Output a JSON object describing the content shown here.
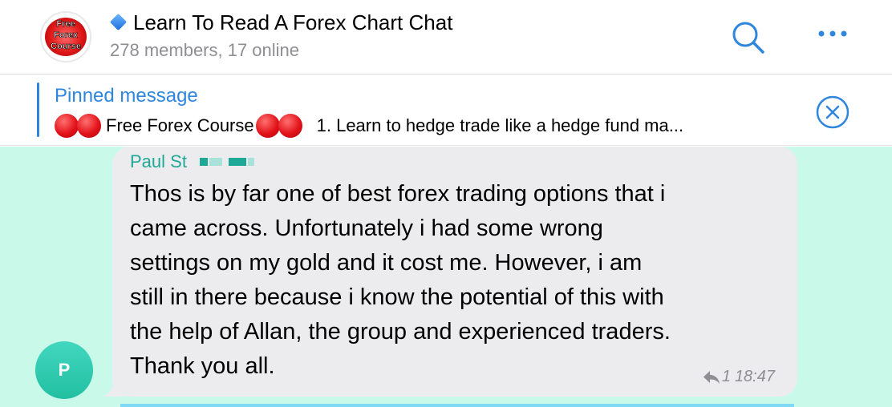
{
  "header": {
    "avatar_logo_lines": [
      "Free",
      "Forex",
      "Course"
    ],
    "title": "Learn To Read A Forex Chart Chat",
    "subtitle": "278 members, 17 online",
    "title_icon": "blue-diamond-icon",
    "search_icon": "search-icon",
    "more_icon": "more-icon"
  },
  "pinned": {
    "label": "Pinned message",
    "text_middle": "Free Forex Course",
    "text_end": "1. Learn to hedge trade like a hedge fund ma...",
    "close_icon": "close-circle-icon"
  },
  "message": {
    "sender": "Paul St",
    "text": "Thos is by far one of best forex trading options that i\ncame across.  Unfortunately i had some wrong\nsettings on my gold and it cost me. However, i am\nstill in there because i know the potential of this with\nthe help of Allan, the group and experienced traders.\nThank you all.",
    "reply_count": "1",
    "time": "18:47",
    "avatar_letter": "P"
  },
  "colors": {
    "accent": "#2e86de",
    "chat_background": "#c9fae9",
    "bubble": "#ececee",
    "sender_name": "#1ea896"
  }
}
